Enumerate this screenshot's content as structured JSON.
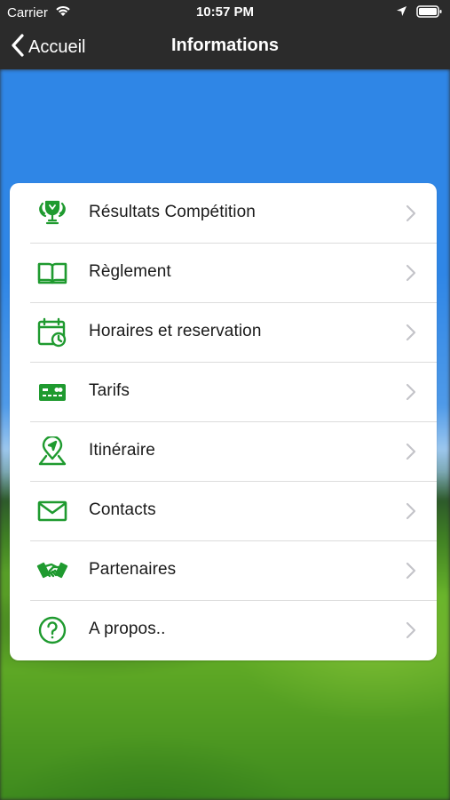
{
  "status_bar": {
    "carrier": "Carrier",
    "time": "10:57 PM",
    "icons": [
      "wifi-icon",
      "location-arrow-icon",
      "battery-icon"
    ]
  },
  "nav": {
    "back_label": "Accueil",
    "title": "Informations"
  },
  "accent_color": "#1f9a2f",
  "menu": {
    "items": [
      {
        "label": "Résultats Compétition",
        "icon": "trophy-icon"
      },
      {
        "label": "Règlement",
        "icon": "book-icon"
      },
      {
        "label": "Horaires et reservation",
        "icon": "calendar-clock-icon"
      },
      {
        "label": "Tarifs",
        "icon": "credit-card-icon"
      },
      {
        "label": "Itinéraire",
        "icon": "map-pin-icon"
      },
      {
        "label": "Contacts",
        "icon": "envelope-icon"
      },
      {
        "label": "Partenaires",
        "icon": "handshake-icon"
      },
      {
        "label": "A propos..",
        "icon": "question-circle-icon"
      }
    ]
  }
}
